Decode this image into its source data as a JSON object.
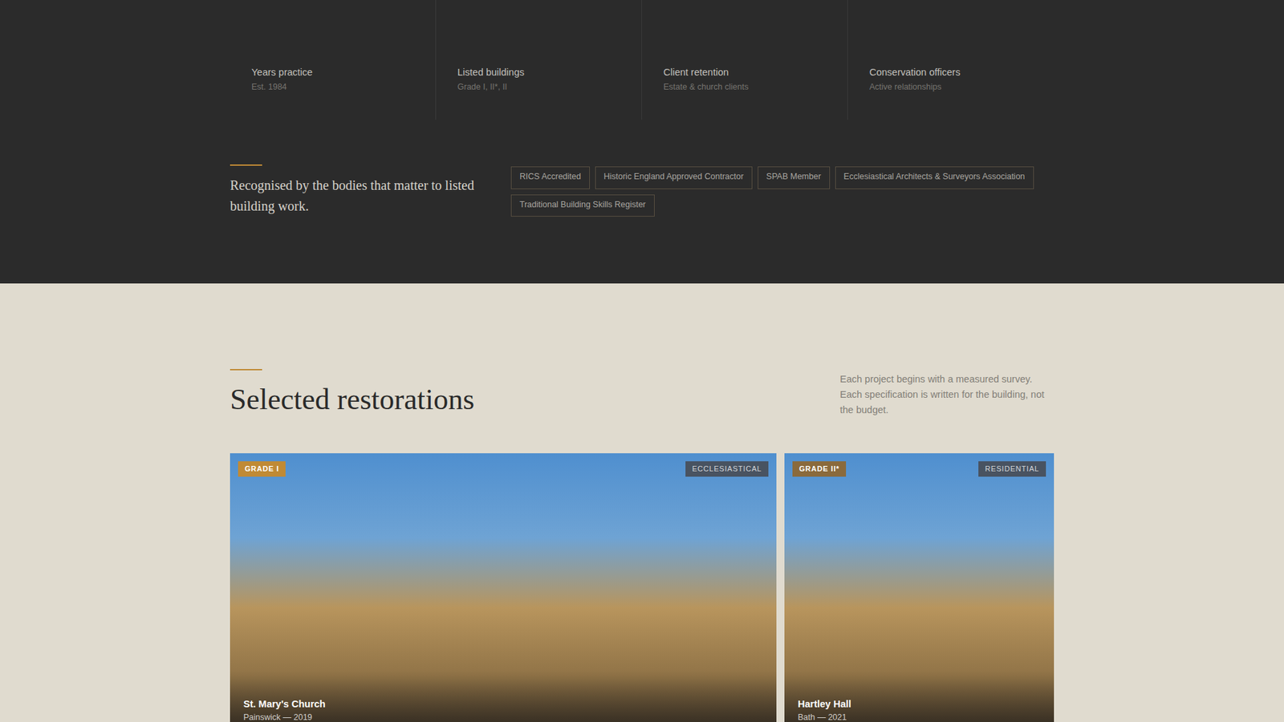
{
  "stats": [
    {
      "label": "Years practice",
      "sub": "Est. 1984"
    },
    {
      "label": "Listed buildings",
      "sub": "Grade I, II*, II"
    },
    {
      "label": "Client retention",
      "sub": "Estate & church clients"
    },
    {
      "label": "Conservation officers",
      "sub": "Active relationships"
    }
  ],
  "accreditation": {
    "heading": "Recognised by the bodies that matter to listed building work.",
    "tags": [
      "RICS Accredited",
      "Historic England Approved Contractor",
      "SPAB Member",
      "Ecclesiastical Architects & Surveyors Association",
      "Traditional Building Skills Register"
    ]
  },
  "projects": {
    "heading": "Selected restorations",
    "intro": "Each project begins with a measured survey. Each specification is written for the building, not the budget.",
    "cards": [
      {
        "grade": "GRADE I",
        "color": "#c08a35",
        "category": "ECCLESIASTICAL",
        "title": "St. Mary's Church",
        "meta": "Painswick — 2019",
        "wide": true
      },
      {
        "grade": "GRADE II*",
        "color": "#8a6a3c",
        "category": "RESIDENTIAL",
        "title": "Hartley Hall",
        "meta": "Bath — 2021",
        "wide": false
      }
    ]
  }
}
